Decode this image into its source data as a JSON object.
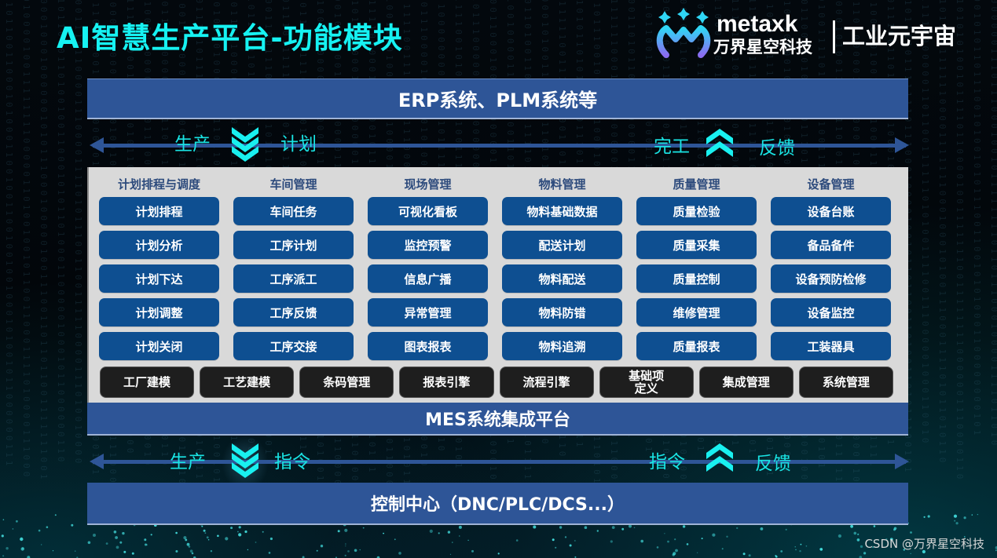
{
  "title": "AI智慧生产平台-功能模块",
  "logo": {
    "icon": "metaxk-m-logo-icon",
    "word": "metaxk",
    "company": "万界星空科技",
    "tagline": "工业元宇宙"
  },
  "erp_band": "ERP系统、PLM系统等",
  "top_flow": {
    "left_label_a": "生产",
    "left_label_b": "计划",
    "left_icon": "double-chevron-down-icon",
    "right_label_a": "完工",
    "right_label_b": "反馈",
    "right_icon": "double-chevron-up-icon"
  },
  "columns": [
    {
      "heading": "计划排程与调度",
      "items": [
        "计划排程",
        "计划分析",
        "计划下达",
        "计划调整",
        "计划关闭"
      ]
    },
    {
      "heading": "车间管理",
      "items": [
        "车间任务",
        "工序计划",
        "工序派工",
        "工序反馈",
        "工序交接"
      ]
    },
    {
      "heading": "现场管理",
      "items": [
        "可视化看板",
        "监控预警",
        "信息广播",
        "异常管理",
        "图表报表"
      ]
    },
    {
      "heading": "物料管理",
      "items": [
        "物料基础数据",
        "配送计划",
        "物料配送",
        "物料防错",
        "物料追溯"
      ]
    },
    {
      "heading": "质量管理",
      "items": [
        "质量检验",
        "质量采集",
        "质量控制",
        "维修管理",
        "质量报表"
      ]
    },
    {
      "heading": "设备管理",
      "items": [
        "设备台账",
        "备品备件",
        "设备预防检修",
        "设备监控",
        "工装器具"
      ]
    }
  ],
  "base_modules": [
    "工厂建模",
    "工艺建模",
    "条码管理",
    "报表引擎",
    "流程引擎",
    "基础项\n定义",
    "集成管理",
    "系统管理"
  ],
  "mes_band": "MES系统集成平台",
  "bottom_flow": {
    "left_label_a": "生产",
    "left_label_b": "指令",
    "left_icon": "double-chevron-down-icon",
    "right_label_a": "指令",
    "right_label_b": "反馈",
    "right_icon": "double-chevron-up-icon"
  },
  "control_band": "控制中心（DNC/PLC/DCS...）",
  "credit": "CSDN @万界星空科技",
  "colors": {
    "title": "#16f2f2",
    "band_blue": "#2e5597",
    "module_blue": "#0e4f91",
    "base_dark": "#1e1e1e",
    "panel_gray": "#d9d9d9",
    "flow_text": "#19e4e4"
  }
}
